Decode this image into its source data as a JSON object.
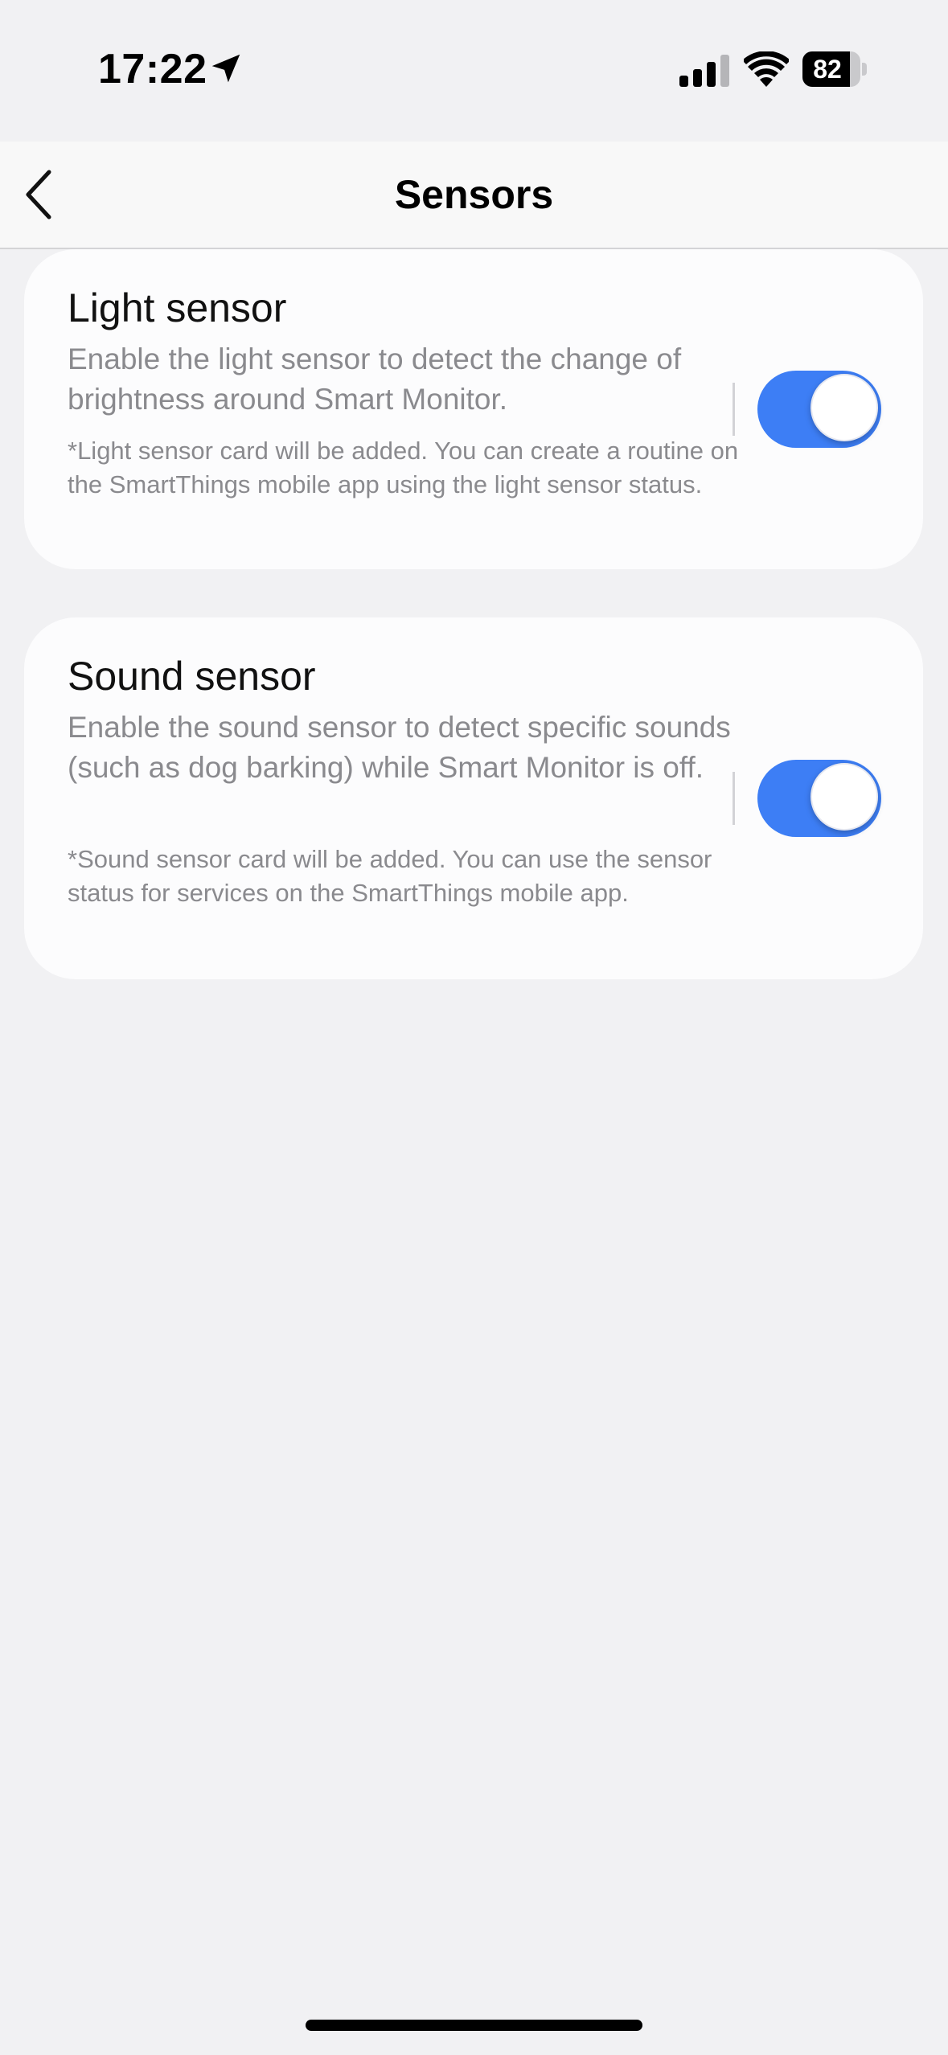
{
  "status_bar": {
    "time": "17:22",
    "battery": "82",
    "battery_level": 0.82,
    "icons": [
      "location-arrow-icon",
      "cellular-signal-icon",
      "wifi-icon",
      "battery-icon"
    ]
  },
  "nav": {
    "title": "Sensors",
    "back_icon": "chevron-left-icon"
  },
  "sensors": [
    {
      "title": "Light sensor",
      "description": "Enable the light sensor to detect the change of brightness around Smart Monitor.",
      "note": "*Light sensor card will be added. You can create a routine on the SmartThings mobile app using the light sensor status.",
      "enabled": true
    },
    {
      "title": "Sound sensor",
      "description": "Enable the sound sensor to detect specific sounds (such as dog barking) while Smart Monitor is off.",
      "note": "*Sound sensor card will be added. You can use the sensor status for services on the SmartThings mobile app.",
      "enabled": true
    }
  ],
  "colors": {
    "background": "#f1f1f3",
    "card": "#fcfcfd",
    "toggle_on": "#3d7ef5",
    "secondary_text": "#8a8a8e"
  }
}
